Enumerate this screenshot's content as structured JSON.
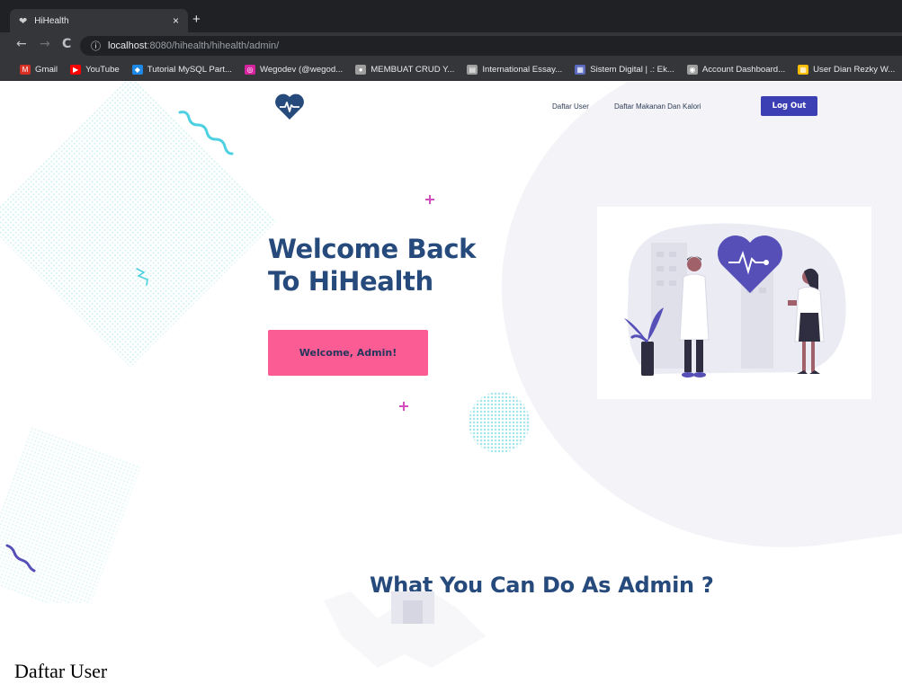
{
  "browser": {
    "tab_title": "HiHealth",
    "tab_close": "×",
    "new_tab": "+",
    "nav": {
      "back": "←",
      "forward": "→",
      "reload": "C"
    },
    "url_info": "ⓘ",
    "url_host": "localhost",
    "url_path": ":8080/hihealth/hihealth/admin/",
    "bookmarks": [
      {
        "label": "Gmail",
        "icon": "gmail-icon",
        "color": "#d93025"
      },
      {
        "label": "YouTube",
        "icon": "youtube-icon",
        "color": "#ff0000"
      },
      {
        "label": "Tutorial MySQL Part...",
        "icon": "code-icon",
        "color": "#1e88e5"
      },
      {
        "label": "Wegodev (@wegod...",
        "icon": "instagram-icon",
        "color": "#d6249f"
      },
      {
        "label": "MEMBUAT CRUD Y...",
        "icon": "bulb-icon",
        "color": "#9e9e9e"
      },
      {
        "label": "International Essay...",
        "icon": "page-icon",
        "color": "#9e9e9e"
      },
      {
        "label": "Sistem Digital | .: Ek...",
        "icon": "puzzle-icon",
        "color": "#5c6bc0"
      },
      {
        "label": "Account Dashboard...",
        "icon": "globe-icon",
        "color": "#9e9e9e"
      },
      {
        "label": "User Dian Rezky W...",
        "icon": "grid-icon",
        "color": "#fbbc04"
      }
    ]
  },
  "page": {
    "nav_links": [
      "Daftar User",
      "Daftar Makanan Dan Kalori"
    ],
    "logout_label": "Log Out",
    "hero_title_line1": "Welcome Back",
    "hero_title_line2": "To HiHealth",
    "welcome_button": "Welcome, Admin!",
    "section_title": "What You Can Do As Admin ?"
  },
  "document_text": "Daftar User",
  "colors": {
    "brand_navy": "#264a7b",
    "logout_bg": "#3c3fb4",
    "welcome_bg": "#fb5c93",
    "heart": "#564fb8",
    "accent_cyan": "#4dd0e1",
    "accent_pink": "#d44dbf"
  }
}
